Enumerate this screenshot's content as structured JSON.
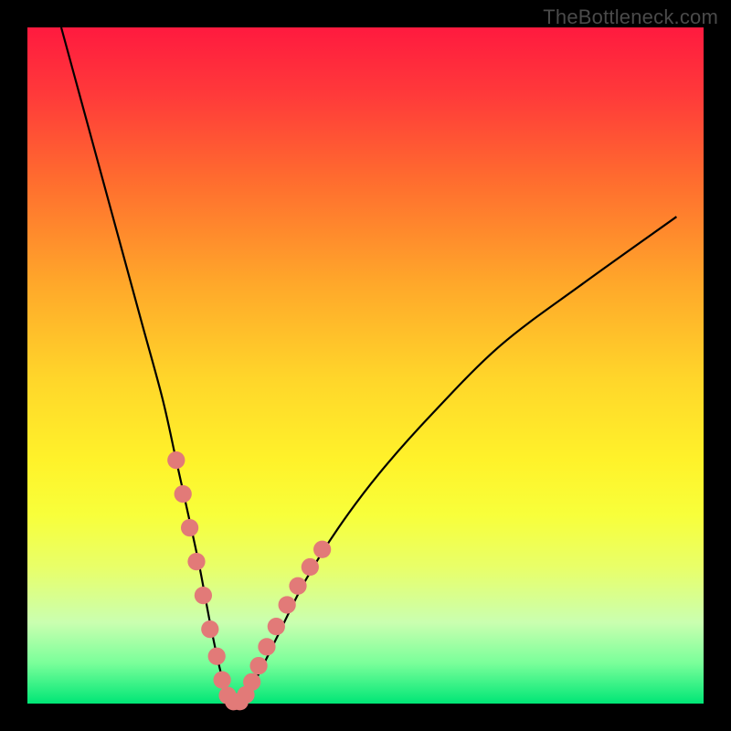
{
  "watermark": "TheBottleneck.com",
  "chart_data": {
    "type": "line",
    "title": "",
    "xlabel": "",
    "ylabel": "",
    "xlim": [
      0,
      100
    ],
    "ylim": [
      0,
      100
    ],
    "grid": false,
    "legend": false,
    "background_gradient": {
      "top": "#ff1a3f",
      "middle": "#ffe82a",
      "bottom": "#00e676"
    },
    "series": [
      {
        "name": "bottleneck-curve",
        "color": "#000000",
        "x": [
          5,
          8,
          11,
          14,
          17,
          20,
          22,
          24,
          25.5,
          27,
          28.5,
          30,
          31.5,
          34,
          37,
          41,
          46,
          52,
          60,
          70,
          82,
          96
        ],
        "y": [
          100,
          89,
          78,
          67,
          56,
          45,
          36,
          27,
          20,
          12,
          5,
          0,
          0,
          4,
          10,
          18,
          26,
          34,
          43,
          53,
          62,
          72
        ]
      }
    ],
    "markers": {
      "name": "highlighted-region",
      "color": "#e27a78",
      "radius_pct": 1.3,
      "points": [
        {
          "x": 22.0,
          "y": 36.0
        },
        {
          "x": 23.0,
          "y": 31.0
        },
        {
          "x": 24.0,
          "y": 26.0
        },
        {
          "x": 25.0,
          "y": 21.0
        },
        {
          "x": 26.0,
          "y": 16.0
        },
        {
          "x": 27.0,
          "y": 11.0
        },
        {
          "x": 28.0,
          "y": 7.0
        },
        {
          "x": 28.8,
          "y": 3.5
        },
        {
          "x": 29.6,
          "y": 1.2
        },
        {
          "x": 30.5,
          "y": 0.3
        },
        {
          "x": 31.4,
          "y": 0.3
        },
        {
          "x": 32.3,
          "y": 1.3
        },
        {
          "x": 33.2,
          "y": 3.2
        },
        {
          "x": 34.2,
          "y": 5.6
        },
        {
          "x": 35.4,
          "y": 8.4
        },
        {
          "x": 36.8,
          "y": 11.4
        },
        {
          "x": 38.4,
          "y": 14.6
        },
        {
          "x": 40.0,
          "y": 17.4
        },
        {
          "x": 41.8,
          "y": 20.2
        },
        {
          "x": 43.6,
          "y": 22.8
        }
      ]
    }
  }
}
